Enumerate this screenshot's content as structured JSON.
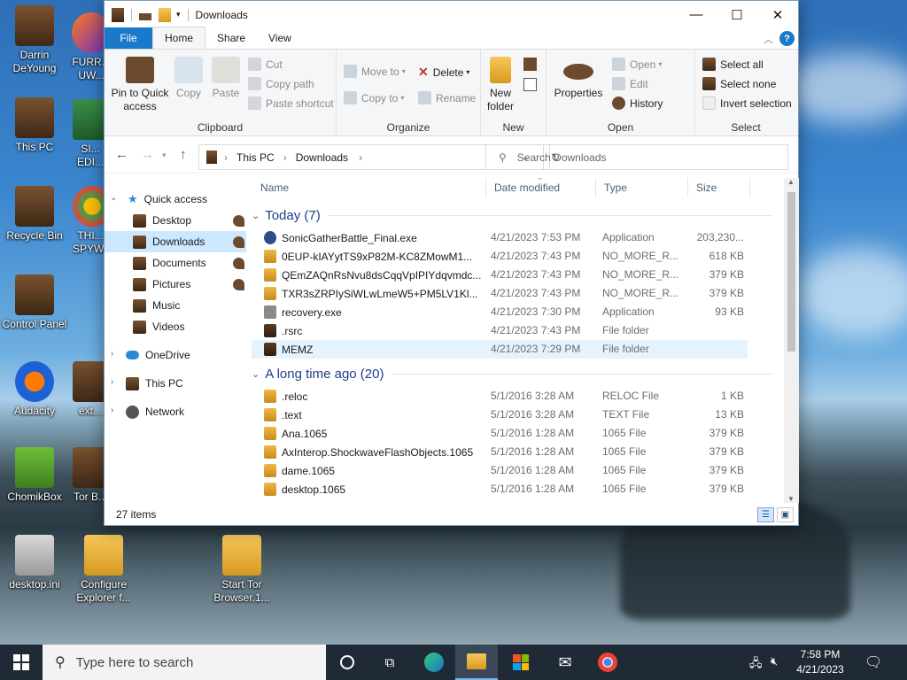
{
  "desktop": {
    "icons": [
      {
        "label": "Darrin DeYoung"
      },
      {
        "label": "FURR... UW..."
      },
      {
        "label": "This PC"
      },
      {
        "label": "SI... EDI..."
      },
      {
        "label": "Recycle Bin"
      },
      {
        "label": "THI... SPYW..."
      },
      {
        "label": "Control Panel"
      },
      {
        "label": "Audacity"
      },
      {
        "label": "ext..."
      },
      {
        "label": "ChomikBox"
      },
      {
        "label": "Tor B..."
      },
      {
        "label": "desktop.ini"
      },
      {
        "label": "Configure Explorer f..."
      },
      {
        "label": "Start Tor Browser.1..."
      }
    ]
  },
  "window": {
    "title": "Downloads",
    "menu_tabs": [
      "File",
      "Home",
      "Share",
      "View"
    ],
    "ribbon": {
      "clipboard": {
        "label": "Clipboard",
        "pin": "Pin to Quick access",
        "copy": "Copy",
        "paste": "Paste",
        "cut": "Cut",
        "copy_path": "Copy path",
        "paste_shortcut": "Paste shortcut"
      },
      "organize": {
        "label": "Organize",
        "move_to": "Move to",
        "copy_to": "Copy to",
        "delete": "Delete",
        "rename": "Rename"
      },
      "new": {
        "label": "New",
        "new_folder": "New folder"
      },
      "open": {
        "label": "Open",
        "properties": "Properties",
        "open": "Open",
        "edit": "Edit",
        "history": "History"
      },
      "select": {
        "label": "Select",
        "select_all": "Select all",
        "select_none": "Select none",
        "invert": "Invert selection"
      }
    },
    "address": {
      "crumbs": [
        "This PC",
        "Downloads"
      ],
      "search_placeholder": "Search Downloads"
    },
    "nav": {
      "quick_access": "Quick access",
      "items": [
        "Desktop",
        "Downloads",
        "Documents",
        "Pictures",
        "Music",
        "Videos"
      ],
      "onedrive": "OneDrive",
      "this_pc": "This PC",
      "network": "Network"
    },
    "columns": {
      "name": "Name",
      "date": "Date modified",
      "type": "Type",
      "size": "Size"
    },
    "groups": [
      {
        "title": "Today (7)",
        "files": [
          {
            "name": "SonicGatherBattle_Final.exe",
            "date": "4/21/2023 7:53 PM",
            "type": "Application",
            "size": "203,230..."
          },
          {
            "name": "0EUP-kIAYytTS9xP82M-KC8ZMowM1...",
            "date": "4/21/2023 7:43 PM",
            "type": "NO_MORE_R...",
            "size": "618 KB"
          },
          {
            "name": "QEmZAQnRsNvu8dsCqqVpIPIYdqvmdc...",
            "date": "4/21/2023 7:43 PM",
            "type": "NO_MORE_R...",
            "size": "379 KB"
          },
          {
            "name": "TXR3sZRPIySiWLwLmeW5+PM5LV1Kl...",
            "date": "4/21/2023 7:43 PM",
            "type": "NO_MORE_R...",
            "size": "379 KB"
          },
          {
            "name": "recovery.exe",
            "date": "4/21/2023 7:30 PM",
            "type": "Application",
            "size": "93 KB"
          },
          {
            "name": ".rsrc",
            "date": "4/21/2023 7:43 PM",
            "type": "File folder",
            "size": ""
          },
          {
            "name": "MEMZ",
            "date": "4/21/2023 7:29 PM",
            "type": "File folder",
            "size": ""
          }
        ]
      },
      {
        "title": "A long time ago (20)",
        "files": [
          {
            "name": ".reloc",
            "date": "5/1/2016 3:28 AM",
            "type": "RELOC File",
            "size": "1 KB"
          },
          {
            "name": ".text",
            "date": "5/1/2016 3:28 AM",
            "type": "TEXT File",
            "size": "13 KB"
          },
          {
            "name": "Ana.1065",
            "date": "5/1/2016 1:28 AM",
            "type": "1065 File",
            "size": "379 KB"
          },
          {
            "name": "AxInterop.ShockwaveFlashObjects.1065",
            "date": "5/1/2016 1:28 AM",
            "type": "1065 File",
            "size": "379 KB"
          },
          {
            "name": "dame.1065",
            "date": "5/1/2016 1:28 AM",
            "type": "1065 File",
            "size": "379 KB"
          },
          {
            "name": "desktop.1065",
            "date": "5/1/2016 1:28 AM",
            "type": "1065 File",
            "size": "379 KB"
          }
        ]
      }
    ],
    "status": "27 items"
  },
  "taskbar": {
    "search_placeholder": "Type here to search",
    "time": "7:58 PM",
    "date": "4/21/2023"
  },
  "colors": {
    "accent": "#1979ca",
    "selected": "#cce8ff",
    "hover": "#e5f3ff",
    "taskbar": "#1f2a36"
  }
}
